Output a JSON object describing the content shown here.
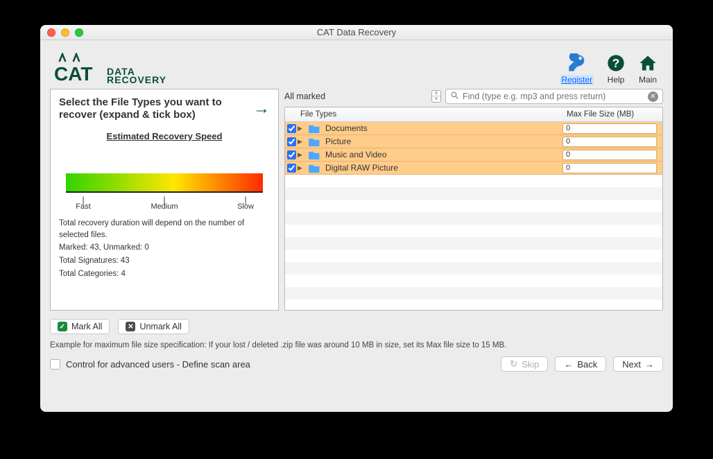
{
  "window": {
    "title": "CAT Data Recovery"
  },
  "logo": {
    "line1": "DATA",
    "line2": "RECOVERY",
    "cat": "CAT"
  },
  "top_icons": {
    "register": "Register",
    "help": "Help",
    "main": "Main"
  },
  "left": {
    "title": "Select the File Types you want to recover (expand & tick box)",
    "ers": "Estimated Recovery Speed",
    "ticks": {
      "fast": "Fast",
      "medium": "Medium",
      "slow": "Slow"
    },
    "note": "Total recovery duration will depend on the number of selected files.",
    "marked": "Marked: 43, Unmarked: 0",
    "sigs": "Total Signatures: 43",
    "cats": "Total Categories: 4"
  },
  "right": {
    "allmarked": "All marked",
    "search_placeholder": "Find (type e.g. mp3 and press return)",
    "col_types": "File Types",
    "col_size": "Max File Size (MB)",
    "rows": [
      {
        "name": "Documents",
        "size": "0"
      },
      {
        "name": "Picture",
        "size": "0"
      },
      {
        "name": "Music and Video",
        "size": "0"
      },
      {
        "name": "Digital RAW Picture",
        "size": "0"
      }
    ]
  },
  "buttons": {
    "mark_all": "Mark All",
    "unmark_all": "Unmark All"
  },
  "example": "Example for maximum file size specification: If your lost / deleted .zip file was around 10 MB in size, set its Max file size to 15 MB.",
  "advanced": "Control for advanced users - Define scan area",
  "nav": {
    "skip": "Skip",
    "back": "Back",
    "next": "Next"
  }
}
